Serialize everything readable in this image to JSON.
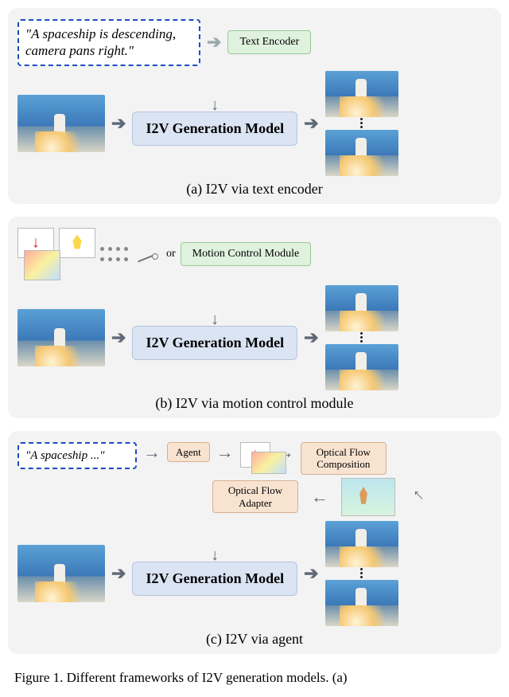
{
  "panel_a": {
    "prompt": "\"A spaceship is descending, camera pans right.\"",
    "encoder_label": "Text Encoder",
    "model_label": "I2V Generation Model",
    "caption": "(a) I2V via text encoder"
  },
  "panel_b": {
    "or_label": "or",
    "module_label": "Motion Control Module",
    "model_label": "I2V Generation Model",
    "caption": "(b) I2V via motion control module"
  },
  "panel_c": {
    "prompt": "\"A spaceship ...\"",
    "agent_label": "Agent",
    "flow_comp_label": "Optical Flow Composition",
    "flow_adapter_label": "Optical Flow Adapter",
    "model_label": "I2V Generation Model",
    "caption": "(c) I2V via agent"
  },
  "figure_caption": "Figure 1.  Different frameworks of I2V generation models.  (a)"
}
